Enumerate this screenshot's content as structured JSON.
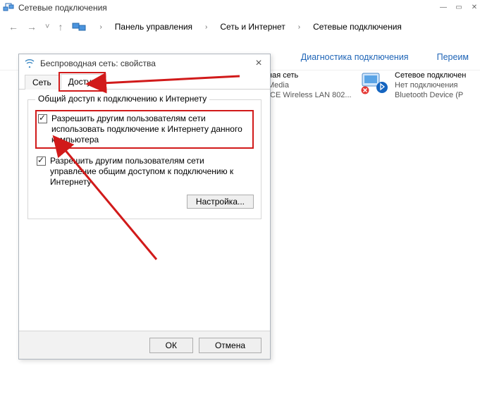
{
  "window": {
    "title": "Сетевые подключения"
  },
  "breadcrumbs": {
    "cpl": "Панель управления",
    "net": "Сеть и Интернет",
    "conn": "Сетевые подключения"
  },
  "commands": {
    "diag": "Диагностика подключения",
    "rename": "Переим"
  },
  "adapters": {
    "a1": {
      "title": "ная сеть",
      "sub1": "Media",
      "sub2": "ICE Wireless LAN 802..."
    },
    "a2": {
      "title": "Сетевое подключен",
      "sub1": "Нет подключения",
      "sub2": "Bluetooth Device (P"
    }
  },
  "dialog": {
    "title": "Беспроводная сеть: свойства",
    "tab_net": "Сеть",
    "tab_share": "Доступ",
    "group": "Общий доступ к подключению к Интернету",
    "chk1": "Разрешить другим пользователям сети использовать подключение к Интернету данного компьютера",
    "chk2": "Разрешить другим пользователям сети управление общим доступом к подключению к Интернету",
    "settings": "Настройка...",
    "ok": "ОК",
    "cancel": "Отмена"
  }
}
